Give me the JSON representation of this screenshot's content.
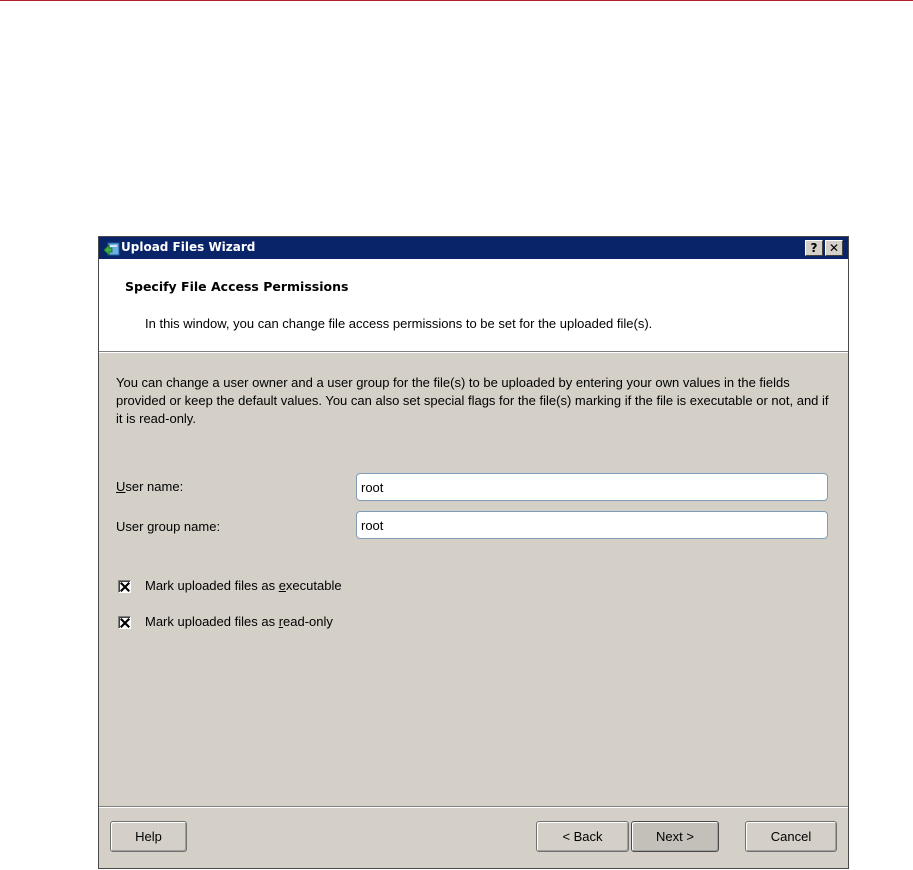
{
  "window": {
    "title": "Upload Files Wizard",
    "help_button": "?",
    "close_button": "✕"
  },
  "header": {
    "title": "Specify File Access Permissions",
    "subtitle": "In this window, you can change file access permissions to be set for the uploaded file(s)."
  },
  "body": {
    "description": "You can change a user owner and a user group for the file(s) to be uploaded by entering your own values in the fields provided or keep the default values. You can also set special flags for the file(s) marking if the file is executable or not, and if it is read-only."
  },
  "form": {
    "user_name": {
      "label_mnemonic": "U",
      "label_rest": "ser name:",
      "value": "root"
    },
    "user_group": {
      "label_pre": "User ",
      "label_mnemonic": "g",
      "label_rest": "roup name:",
      "value": "root"
    },
    "executable": {
      "label_pre": "Mark uploaded files as ",
      "label_mnemonic": "e",
      "label_rest": "xecutable",
      "checked": true
    },
    "read_only": {
      "label_pre": "Mark uploaded files as ",
      "label_mnemonic": "r",
      "label_rest": "ead-only",
      "checked": true
    }
  },
  "buttons": {
    "help": "Help",
    "back": "< Back",
    "next": "Next >",
    "cancel": "Cancel"
  },
  "colors": {
    "titlebar": "#0a246a",
    "dialog_face": "#d4d0c8",
    "header_bg": "#ffffff",
    "top_rule": "#b5222f"
  },
  "icons": {
    "app": "upload-files-icon",
    "checkmark": "check-x-icon"
  }
}
